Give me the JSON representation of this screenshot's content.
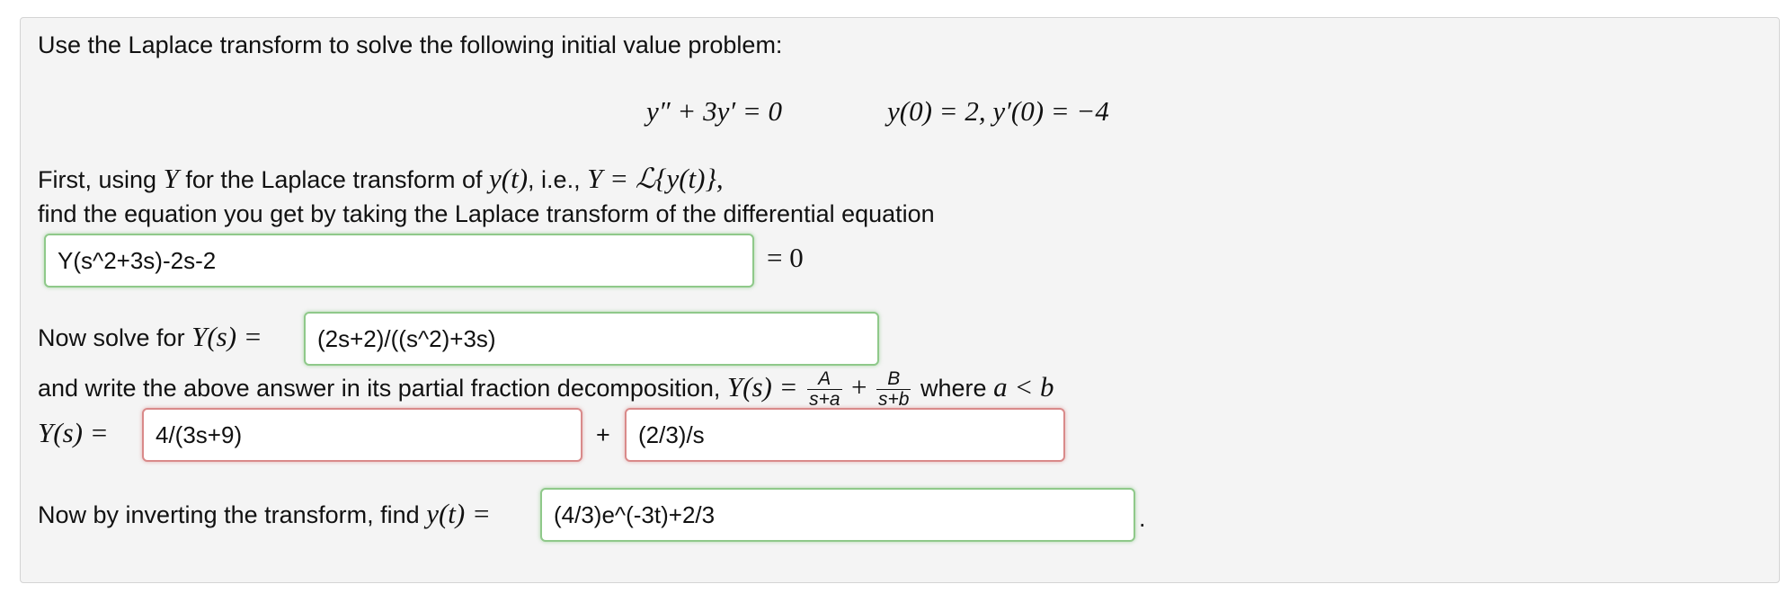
{
  "problem": {
    "intro": "Use the Laplace transform to solve the following initial value problem:",
    "ode": "y″ + 3y′ = 0",
    "initial_conditions": "y(0) = 2,  y′(0) = −4"
  },
  "step1": {
    "line1_prefix": "First, using",
    "line1_var": "Y",
    "line1_mid": "for the Laplace transform of",
    "line1_func": "y(t)",
    "line1_ie": ", i.e.,",
    "line1_def": "Y = ℒ{y(t)},",
    "line2": "find the equation you get by taking the Laplace transform of the differential equation",
    "answer": "Y(s^2+3s)-2s-2",
    "equals_zero": "= 0"
  },
  "step2": {
    "prefix": "Now solve for",
    "lhs": "Y(s) =",
    "answer": "(2s+2)/((s^2)+3s)"
  },
  "step3": {
    "text": "and write the above answer in its partial fraction decomposition,",
    "lhs": "Y(s) =",
    "frac1_num": "A",
    "frac1_den": "s+a",
    "plus": "+",
    "frac2_num": "B",
    "frac2_den": "s+b",
    "where": "where",
    "condition": "a < b",
    "row_lhs": "Y(s) =",
    "answer1": "4/(3s+9)",
    "row_plus": "+",
    "answer2": "(2/3)/s"
  },
  "step4": {
    "prefix": "Now by inverting the transform, find",
    "lhs": "y(t) =",
    "answer": "(4/3)e^(-3t)+2/3",
    "period": "."
  },
  "colors": {
    "correct_border": "#8fc98a",
    "incorrect_border": "#d98a8a",
    "panel_bg": "#f4f4f4"
  }
}
